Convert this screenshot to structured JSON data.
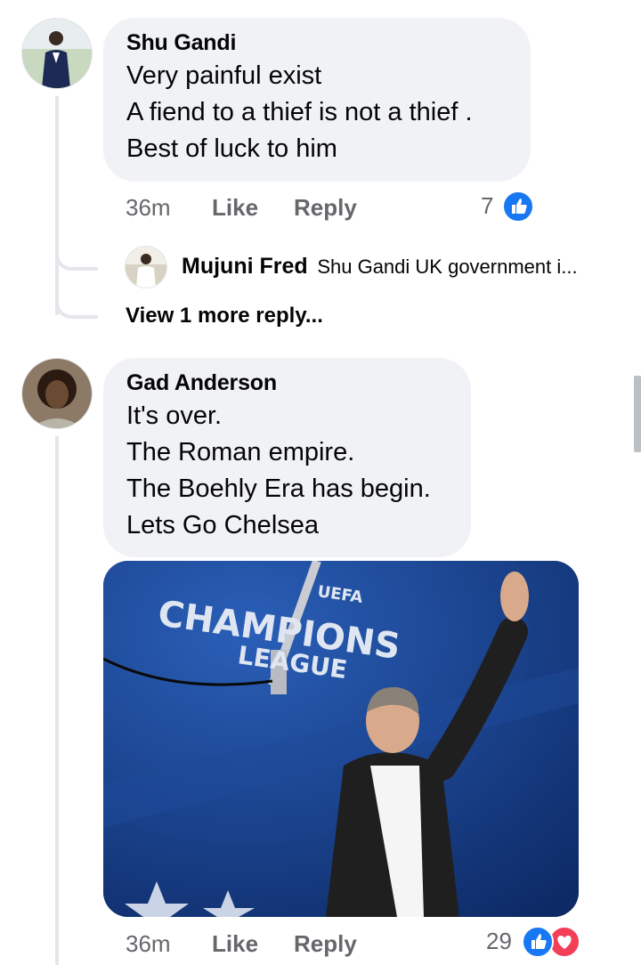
{
  "comments": [
    {
      "author": "Shu Gandi",
      "lines": [
        "Very painful exist",
        "A fiend to a thief is not a thief .",
        "Best of luck to him"
      ],
      "time": "36m",
      "like_label": "Like",
      "reply_label": "Reply",
      "reaction_count": "7"
    },
    {
      "author": "Gad Anderson",
      "lines": [
        "It's over.",
        "The Roman empire.",
        "The Boehly Era has begin.",
        "Lets Go Chelsea"
      ],
      "time": "36m",
      "like_label": "Like",
      "reply_label": "Reply",
      "reaction_count": "29",
      "image_text": [
        "CHAMPIONS",
        "LEAGUE",
        "UEFA"
      ]
    }
  ],
  "reply_preview": {
    "author": "Mujuni Fred",
    "text": "Shu Gandi UK government i..."
  },
  "view_more": "View 1 more reply...",
  "colors": {
    "bubble": "#f0f2f5",
    "secondary_text": "#65676b",
    "like_blue": "#1877f2",
    "love_red": "#f33e58"
  }
}
